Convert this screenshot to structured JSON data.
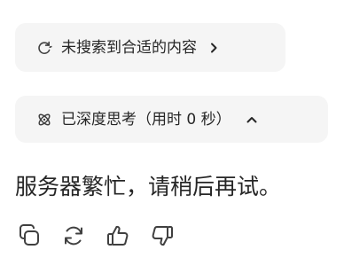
{
  "search_chip": {
    "icon": "refresh-search-icon",
    "label": "未搜索到合适的内容",
    "chevron": "chevron-right-icon"
  },
  "thinking_chip": {
    "icon": "deep-think-icon",
    "label": "已深度思考（用时 0 秒）",
    "chevron": "chevron-up-icon"
  },
  "message": {
    "text": "服务器繁忙，请稍后再试。"
  },
  "actions": [
    {
      "icon": "copy-icon"
    },
    {
      "icon": "regenerate-icon"
    },
    {
      "icon": "thumbs-up-icon"
    },
    {
      "icon": "thumbs-down-icon"
    }
  ],
  "colors": {
    "chip_bg": "#f5f5f5",
    "text": "#262626",
    "icon": "#404040"
  }
}
